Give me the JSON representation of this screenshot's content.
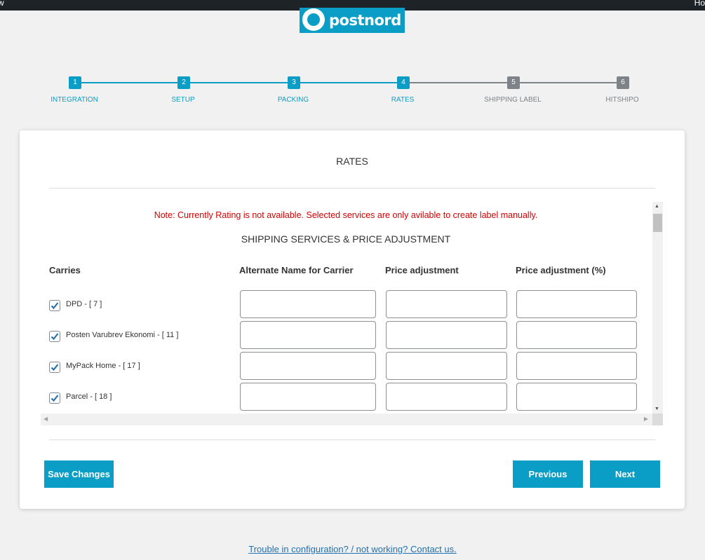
{
  "topbar": {
    "left_text": "w",
    "right_text": "Ho"
  },
  "logo": {
    "text": "postnord"
  },
  "colors": {
    "accent": "#0a9ec7",
    "inactive": "#7d8388",
    "error": "#d40000",
    "link": "#2271b1"
  },
  "steps": [
    {
      "num": "1",
      "label": "INTEGRATION",
      "active": true
    },
    {
      "num": "2",
      "label": "SETUP",
      "active": true
    },
    {
      "num": "3",
      "label": "PACKING",
      "active": true
    },
    {
      "num": "4",
      "label": "RATES",
      "active": true
    },
    {
      "num": "5",
      "label": "SHIPPING LABEL",
      "active": false
    },
    {
      "num": "6",
      "label": "HITSHIPO",
      "active": false
    }
  ],
  "card": {
    "title": "RATES"
  },
  "note": "Note: Currently Rating is not available. Selected services are only avilable to create label manually.",
  "section_title": "SHIPPING SERVICES & PRICE ADJUSTMENT",
  "columns": {
    "carries": "Carries",
    "alt_name": "Alternate Name for Carrier",
    "price_adj": "Price adjustment",
    "price_adj_pct": "Price adjustment (%)"
  },
  "rows": [
    {
      "label": "DPD - [ 7 ]",
      "checked": true,
      "alt_name": "",
      "price_adj": "",
      "price_adj_pct": ""
    },
    {
      "label": "Posten Varubrev Ekonomi - [ 11 ]",
      "checked": true,
      "alt_name": "",
      "price_adj": "",
      "price_adj_pct": ""
    },
    {
      "label": "MyPack Home - [ 17 ]",
      "checked": true,
      "alt_name": "",
      "price_adj": "",
      "price_adj_pct": ""
    },
    {
      "label": "Parcel - [ 18 ]",
      "checked": true,
      "alt_name": "",
      "price_adj": "",
      "price_adj_pct": ""
    },
    {
      "label": "",
      "checked": true,
      "alt_name": "",
      "price_adj": "",
      "price_adj_pct": ""
    }
  ],
  "buttons": {
    "save": "Save Changes",
    "previous": "Previous",
    "next": "Next"
  },
  "footer": {
    "link_text": "Trouble in configuration? / not working? Contact us."
  }
}
